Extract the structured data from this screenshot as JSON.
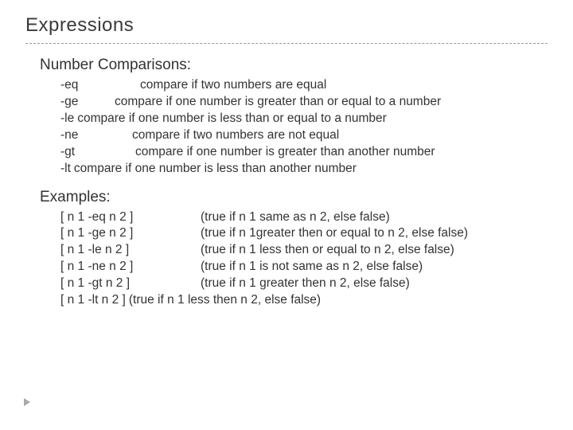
{
  "title": "Expressions",
  "sections": [
    {
      "heading": "Number Comparisons:",
      "rows": [
        {
          "op": "-eq",
          "wclass": "w-eq",
          "desc": "compare if two numbers are equal"
        },
        {
          "op": "-ge",
          "wclass": "w-ge",
          "desc": "compare if one number is greater than or equal to a number"
        },
        {
          "op": "-le",
          "wclass": "w-le",
          "desc": "compare if one number is less than or equal to a number"
        },
        {
          "op": "-ne",
          "wclass": "w-ne",
          "desc": "compare if two numbers are not equal"
        },
        {
          "op": "-gt",
          "wclass": "w-gt",
          "desc": "compare if one number is greater than another number"
        },
        {
          "op": "-lt",
          "wclass": "w-lt",
          "desc": "compare if one number is less than another number"
        }
      ]
    },
    {
      "heading": "Examples:",
      "rows": [
        {
          "code": "[ n 1 -eq n 2 ]",
          "wclass": "wex-0",
          "desc": "(true if n 1 same as n 2, else false)"
        },
        {
          "code": "[ n 1 -ge n 2 ]",
          "wclass": "wex-1",
          "desc": "(true if n 1greater then or equal to n 2, else false)"
        },
        {
          "code": "[ n 1 -le n 2 ]",
          "wclass": "wex-2",
          "desc": "(true if n 1 less then or equal to n 2, else false)"
        },
        {
          "code": "[ n 1 -ne n 2 ]",
          "wclass": "wex-3",
          "desc": "(true if n 1 is not same as n 2, else false)"
        },
        {
          "code": "[ n 1 -gt n 2 ]",
          "wclass": "wex-4",
          "desc": "(true if n 1 greater then n 2, else false)"
        },
        {
          "code": "[ n 1 -lt n 2 ]",
          "wclass": "wex-5",
          "desc": "(true if n 1 less then n 2, else false)"
        }
      ]
    }
  ],
  "bullets": {
    "main": "",
    "sub": ""
  }
}
